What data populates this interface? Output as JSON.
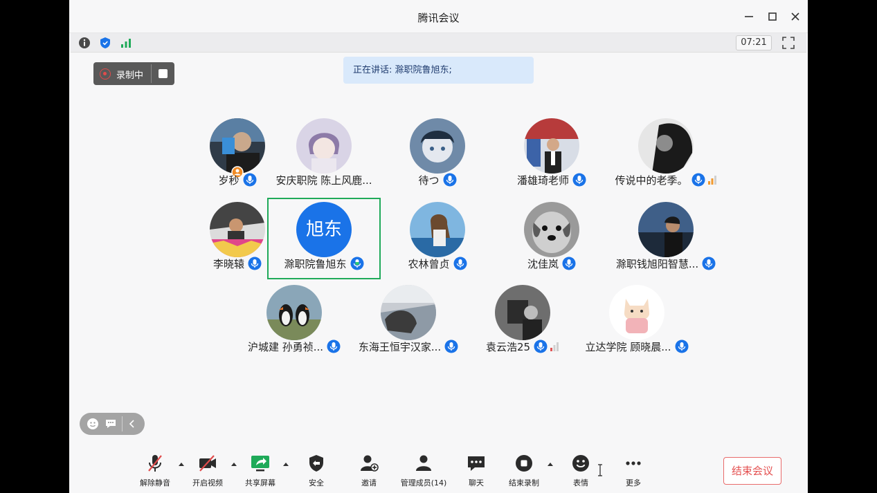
{
  "window": {
    "title": "腾讯会议"
  },
  "infobar": {
    "timer": "07:21"
  },
  "recording": {
    "label": "录制中"
  },
  "speaker": {
    "text": "正在讲话: 滁职院鲁旭东;"
  },
  "participants": [
    {
      "name": "岁秒"
    },
    {
      "name": "安庆职院 陈上风鹿..."
    },
    {
      "name": "待つ"
    },
    {
      "name": "潘雄琦老师"
    },
    {
      "name": "传说中的老季。"
    },
    {
      "name": "李晓辕"
    },
    {
      "name": "滁职院鲁旭东",
      "avatar_text": "旭东"
    },
    {
      "name": "农林曾贞"
    },
    {
      "name": "沈佳岚"
    },
    {
      "name": "滁职钱旭阳智慧..."
    },
    {
      "name": "沪城建 孙勇祯..."
    },
    {
      "name": "东海王恒宇汉家..."
    },
    {
      "name": "袁云浩25"
    },
    {
      "name": "立达学院 顾晓晨..."
    }
  ],
  "toolbar": {
    "unmute": "解除静音",
    "video": "开启视频",
    "share": "共享屏幕",
    "security": "安全",
    "invite": "邀请",
    "members": "管理成员(14)",
    "chat": "聊天",
    "stop_record": "结束录制",
    "reactions": "表情",
    "more": "更多",
    "end": "结束会议"
  },
  "colors": {
    "accent": "#1a73e8",
    "active_border": "#1faa59",
    "end_red": "#e45151"
  }
}
